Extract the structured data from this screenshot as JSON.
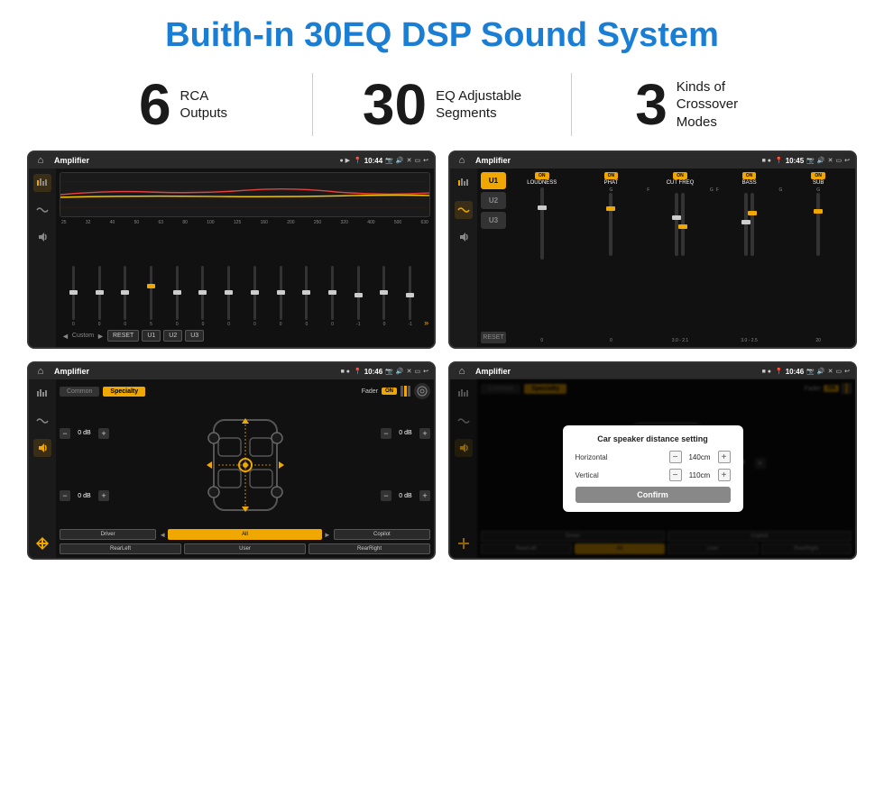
{
  "title": "Buith-in 30EQ DSP Sound System",
  "stats": [
    {
      "number": "6",
      "label": "RCA\nOutputs"
    },
    {
      "number": "30",
      "label": "EQ Adjustable\nSegments"
    },
    {
      "number": "3",
      "label": "Kinds of\nCrossover Modes"
    }
  ],
  "screens": {
    "eq": {
      "appTitle": "Amplifier",
      "time": "10:44",
      "freqLabels": [
        "25",
        "32",
        "40",
        "50",
        "63",
        "80",
        "100",
        "125",
        "160",
        "200",
        "250",
        "320",
        "400",
        "500",
        "630"
      ],
      "sliderVals": [
        "0",
        "0",
        "0",
        "5",
        "0",
        "0",
        "0",
        "0",
        "0",
        "0",
        "0",
        "-1",
        "0",
        "-1"
      ],
      "buttons": [
        "Custom",
        "RESET",
        "U1",
        "U2",
        "U3"
      ]
    },
    "crossover": {
      "appTitle": "Amplifier",
      "time": "10:45",
      "uButtons": [
        "U1",
        "U2",
        "U3"
      ],
      "channels": [
        {
          "name": "LOUDNESS",
          "on": true
        },
        {
          "name": "PHAT",
          "on": true
        },
        {
          "name": "CUT FREQ",
          "on": true
        },
        {
          "name": "BASS",
          "on": true
        },
        {
          "name": "SUB",
          "on": true
        }
      ]
    },
    "fader": {
      "appTitle": "Amplifier",
      "time": "10:46",
      "tabs": [
        "Common",
        "Specialty"
      ],
      "faderLabel": "Fader",
      "faderOn": "ON",
      "volumeControls": {
        "topLeft": "0 dB",
        "bottomLeft": "0 dB",
        "topRight": "0 dB",
        "bottomRight": "0 dB"
      },
      "buttons": [
        "Driver",
        "Copilot",
        "RearLeft",
        "All",
        "User",
        "RearRight"
      ]
    },
    "dialog": {
      "appTitle": "Amplifier",
      "time": "10:46",
      "title": "Car speaker distance setting",
      "horizontal": {
        "label": "Horizontal",
        "value": "140cm"
      },
      "vertical": {
        "label": "Vertical",
        "value": "110cm"
      },
      "confirmBtn": "Confirm",
      "tabs": [
        "Common",
        "Specialty"
      ],
      "buttons": [
        "Driver",
        "Copilot",
        "RearLeft",
        "All",
        "User",
        "RearRight"
      ],
      "volumeRight": {
        "top": "0 dB",
        "bottom": "0 dB"
      }
    }
  }
}
